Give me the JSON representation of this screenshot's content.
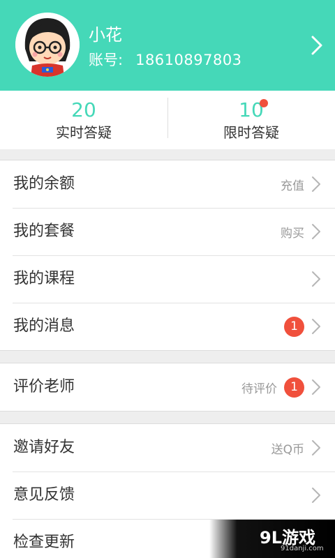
{
  "profile": {
    "name": "小花",
    "account_label": "账号:",
    "account_number": "18610897803",
    "avatar_icon": "cartoon-girl-avatar",
    "chevron_icon": "chevron-right-icon"
  },
  "stats": [
    {
      "count": "20",
      "label": "实时答疑"
    },
    {
      "count": "10",
      "label": "限时答疑",
      "has_dot": true
    }
  ],
  "groups": [
    {
      "rows": [
        {
          "label": "我的余额",
          "hint": "充值"
        },
        {
          "label": "我的套餐",
          "hint": "购买"
        },
        {
          "label": "我的课程"
        },
        {
          "label": "我的消息",
          "badge": "1"
        }
      ]
    },
    {
      "rows": [
        {
          "label": "评价老师",
          "hint": "待评价",
          "badge": "1"
        }
      ]
    },
    {
      "rows": [
        {
          "label": "邀请好友",
          "hint": "送Q币"
        },
        {
          "label": "意见反馈"
        },
        {
          "label": "检查更新"
        }
      ]
    }
  ],
  "watermark": {
    "logo": "9L游戏",
    "url": "91danji.com"
  },
  "colors": {
    "brand": "#45d8b8",
    "badge": "#f0503c"
  }
}
